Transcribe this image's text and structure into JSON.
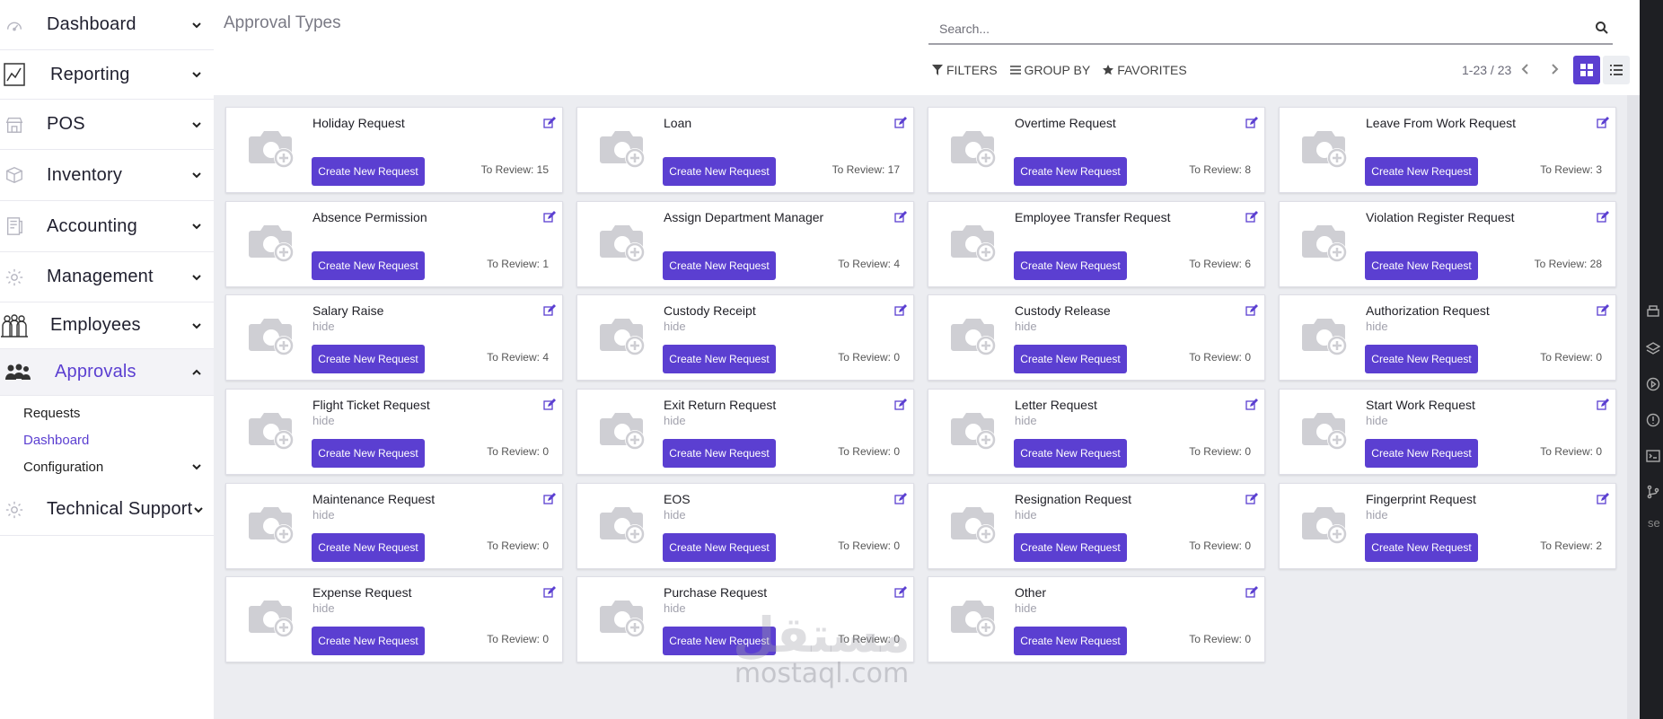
{
  "sidebar": {
    "items": [
      {
        "label": "Dashboard",
        "icon": "speedometer-icon"
      },
      {
        "label": "Reporting",
        "icon": "chart-icon"
      },
      {
        "label": "POS",
        "icon": "store-icon"
      },
      {
        "label": "Inventory",
        "icon": "boxes-icon"
      },
      {
        "label": "Accounting",
        "icon": "ledger-icon"
      },
      {
        "label": "Management",
        "icon": "gear-icon"
      },
      {
        "label": "Employees",
        "icon": "people-icon"
      },
      {
        "label": "Approvals",
        "icon": "users-icon"
      },
      {
        "label": "Technical Support",
        "icon": "gear-icon"
      }
    ],
    "approvals_sub": [
      "Requests",
      "Dashboard",
      "Configuration"
    ]
  },
  "header": {
    "title": "Approval Types",
    "search_placeholder": "Search...",
    "filters_label": "FILTERS",
    "groupby_label": "GROUP BY",
    "favorites_label": "FAVORITES",
    "pager": "1-23 / 23"
  },
  "button_label": "Create New Request",
  "cards": [
    {
      "title": "Holiday Request",
      "sub": "",
      "review": "To Review: 15"
    },
    {
      "title": "Loan",
      "sub": "",
      "review": "To Review: 17"
    },
    {
      "title": "Overtime Request",
      "sub": "",
      "review": "To Review: 8"
    },
    {
      "title": "Leave From Work Request",
      "sub": "",
      "review": "To Review: 3"
    },
    {
      "title": "Absence Permission",
      "sub": "",
      "review": "To Review: 1"
    },
    {
      "title": "Assign Department Manager",
      "sub": "",
      "review": "To Review: 4"
    },
    {
      "title": "Employee Transfer Request",
      "sub": "",
      "review": "To Review: 6"
    },
    {
      "title": "Violation Register Request",
      "sub": "",
      "review": "To Review: 28"
    },
    {
      "title": "Salary Raise",
      "sub": "hide",
      "review": "To Review: 4"
    },
    {
      "title": "Custody Receipt",
      "sub": "hide",
      "review": "To Review: 0"
    },
    {
      "title": "Custody Release",
      "sub": "hide",
      "review": "To Review: 0"
    },
    {
      "title": "Authorization Request",
      "sub": "hide",
      "review": "To Review: 0"
    },
    {
      "title": "Flight Ticket Request",
      "sub": "hide",
      "review": "To Review: 0"
    },
    {
      "title": "Exit Return Request",
      "sub": "hide",
      "review": "To Review: 0"
    },
    {
      "title": "Letter Request",
      "sub": "hide",
      "review": "To Review: 0"
    },
    {
      "title": "Start Work Request",
      "sub": "hide",
      "review": "To Review: 0"
    },
    {
      "title": "Maintenance Request",
      "sub": "hide",
      "review": "To Review: 0"
    },
    {
      "title": "EOS",
      "sub": "hide",
      "review": "To Review: 0"
    },
    {
      "title": "Resignation Request",
      "sub": "hide",
      "review": "To Review: 0"
    },
    {
      "title": "Fingerprint Request",
      "sub": "hide",
      "review": "To Review: 2"
    },
    {
      "title": "Expense Request",
      "sub": "hide",
      "review": "To Review: 0"
    },
    {
      "title": "Purchase Request",
      "sub": "hide",
      "review": "To Review: 0"
    },
    {
      "title": "Other",
      "sub": "hide",
      "review": "To Review: 0"
    }
  ],
  "edge_text": "se",
  "watermark": {
    "arabic": "مستقل",
    "latin": "mostaql.com"
  },
  "colors": {
    "accent": "#5b3fd1",
    "background": "#ecedf1"
  }
}
